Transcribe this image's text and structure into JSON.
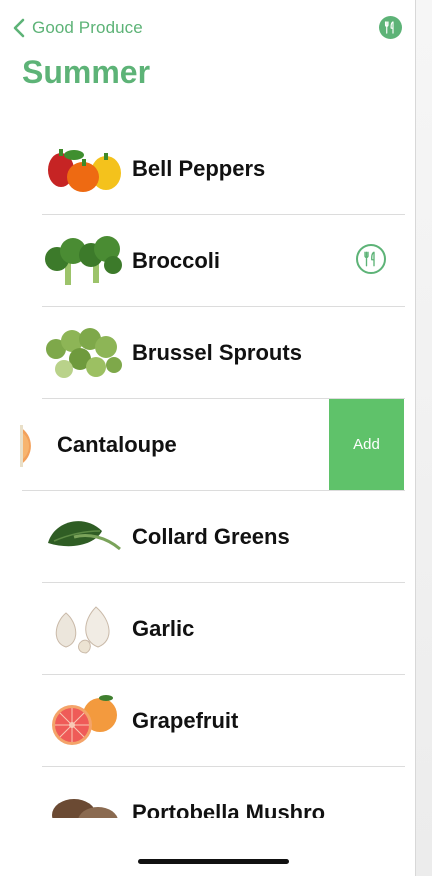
{
  "nav": {
    "back_label": "Good Produce",
    "back_icon": "chevron-left-icon",
    "action_icon": "fork-knife-icon"
  },
  "page": {
    "title": "Summer"
  },
  "produce": [
    {
      "name": "Bell Peppers",
      "image": "bell-peppers-image",
      "in_list": false
    },
    {
      "name": "Broccoli",
      "image": "broccoli-image",
      "in_list": true,
      "status_icon": "fork-knife-icon"
    },
    {
      "name": "Brussel Sprouts",
      "image": "brussel-sprouts-image",
      "in_list": false
    },
    {
      "name": "Cantaloupe",
      "image": "cantaloupe-image",
      "in_list": false,
      "swiped": true,
      "swipe_action": "Add"
    },
    {
      "name": "Collard Greens",
      "image": "collard-greens-image",
      "in_list": false
    },
    {
      "name": "Garlic",
      "image": "garlic-image",
      "in_list": false
    },
    {
      "name": "Grapefruit",
      "image": "grapefruit-image",
      "in_list": false
    },
    {
      "name": "Portobella Mushro",
      "image": "portobello-mushroom-image",
      "in_list": false
    }
  ],
  "colors": {
    "accent": "#5db377",
    "swipe_action": "#5fc26a",
    "text": "#111111",
    "separator": "#dcdcdc"
  }
}
